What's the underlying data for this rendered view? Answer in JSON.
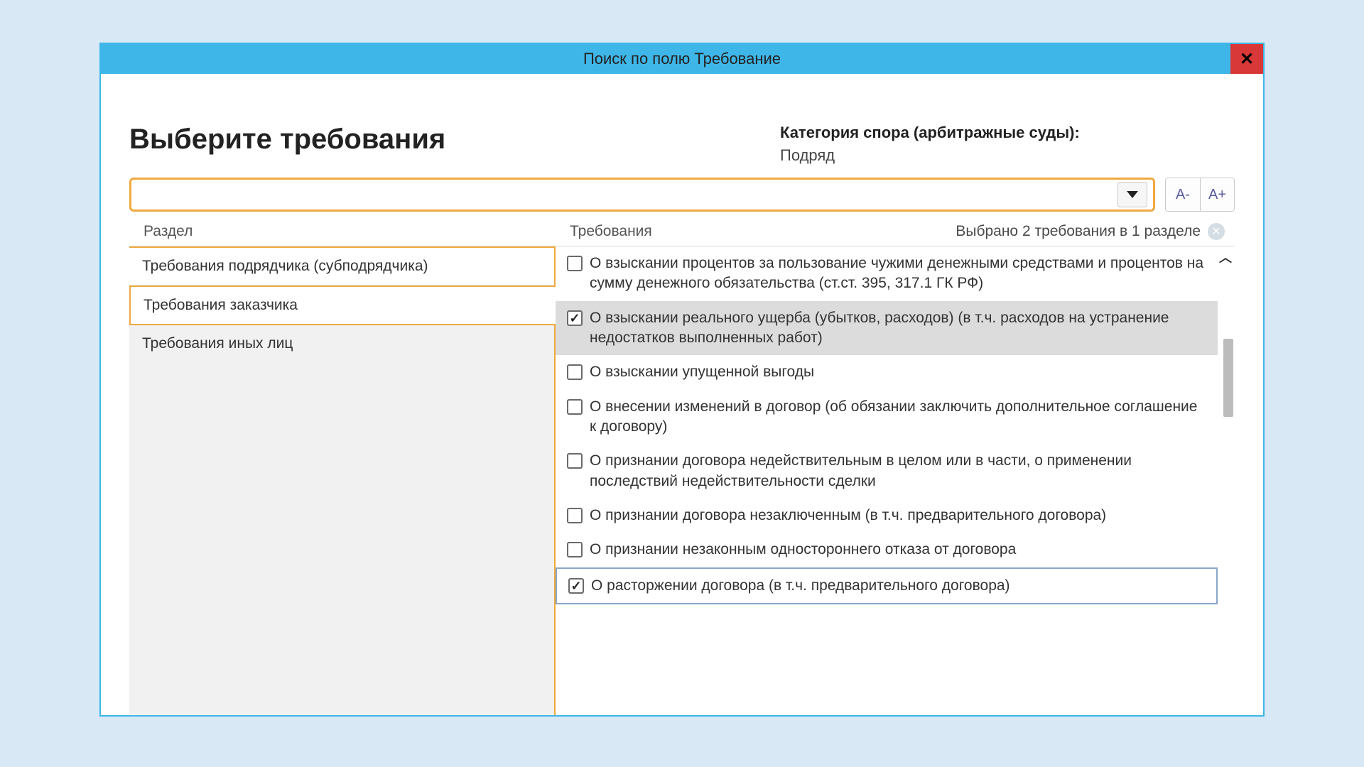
{
  "window": {
    "title": "Поиск по полю Требование"
  },
  "header": {
    "heading": "Выберите требования",
    "category_label": "Категория спора (арбитражные суды):",
    "category_value": "Подряд"
  },
  "search": {
    "value": ""
  },
  "font_controls": {
    "decrease": "A-",
    "increase": "A+"
  },
  "columns": {
    "left_header": "Раздел",
    "right_header": "Требования",
    "selection_summary": "Выбрано 2 требования в 1 разделе"
  },
  "sections": [
    {
      "label": "Требования подрядчика (субподрядчика)",
      "selected": false
    },
    {
      "label": "Требования заказчика",
      "selected": true
    },
    {
      "label": "Требования иных лиц",
      "selected": false
    }
  ],
  "requirements": [
    {
      "text": "О взыскании процентов за пользование чужими денежными средствами и процентов на сумму денежного обязательства (ст.ст. 395, 317.1 ГК РФ)",
      "checked": false,
      "highlight": "none"
    },
    {
      "text": "О взыскании реального ущерба (убытков, расходов) (в т.ч. расходов на устранение недостатков выполненных работ)",
      "checked": true,
      "highlight": "gray"
    },
    {
      "text": "О взыскании упущенной выгоды",
      "checked": false,
      "highlight": "none"
    },
    {
      "text": "О внесении изменений в договор (об обязании заключить дополнительное соглашение к договору)",
      "checked": false,
      "highlight": "none"
    },
    {
      "text": "О признании договора недействительным в целом или в части, о применении последствий недействительности сделки",
      "checked": false,
      "highlight": "none"
    },
    {
      "text": "О признании договора незаключенным (в т.ч. предварительного договора)",
      "checked": false,
      "highlight": "none"
    },
    {
      "text": "О признании незаконным одностороннего отказа от договора",
      "checked": false,
      "highlight": "none"
    },
    {
      "text": "О расторжении договора (в т.ч. предварительного договора)",
      "checked": true,
      "highlight": "blue"
    }
  ]
}
